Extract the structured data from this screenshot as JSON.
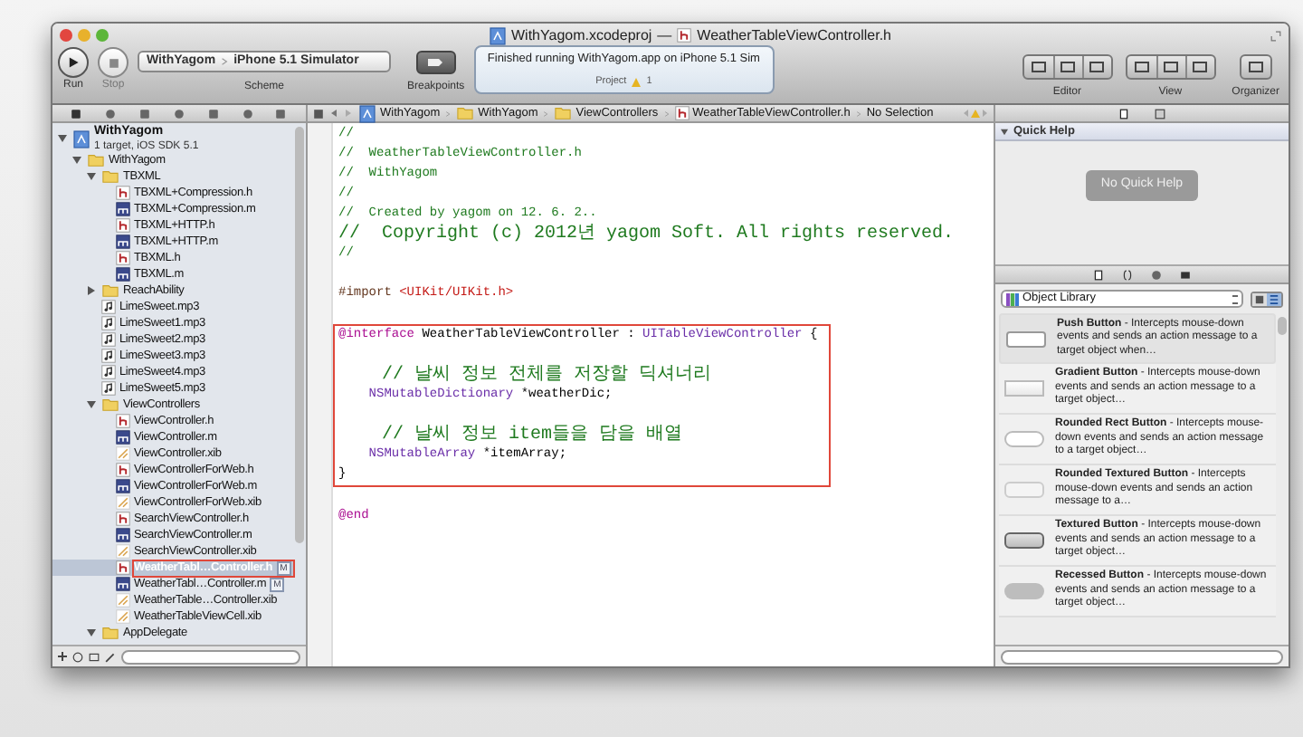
{
  "window": {
    "project": "WithYagom.xcodeproj",
    "separator": "—",
    "file": "WeatherTableViewController.h"
  },
  "toolbar": {
    "run": "Run",
    "stop": "Stop",
    "scheme": "WithYagom",
    "destination": "iPhone 5.1 Simulator",
    "scheme_label": "Scheme",
    "breakpoints": "Breakpoints",
    "editor": "Editor",
    "view": "View",
    "organizer": "Organizer"
  },
  "activity": {
    "status": "Finished running WithYagom.app on iPhone 5.1 Sim",
    "project": "Project",
    "warnings": "1"
  },
  "jump_bar": [
    {
      "kind": "project",
      "label": "WithYagom"
    },
    {
      "kind": "folder",
      "label": "WithYagom"
    },
    {
      "kind": "folder",
      "label": "ViewControllers"
    },
    {
      "kind": "header",
      "label": "WeatherTableViewController.h"
    },
    {
      "kind": "text",
      "label": "No Selection"
    }
  ],
  "navigator": [
    {
      "kind": "project",
      "label": "WithYagom",
      "subtitle": "1 target, iOS SDK 5.1",
      "expanded": true,
      "selected": false,
      "children": [
        {
          "kind": "folder",
          "label": "WithYagom",
          "expanded": true,
          "selected": false,
          "children": [
            {
              "kind": "folder",
              "label": "TBXML",
              "expanded": true,
              "selected": false,
              "children": [
                {
                  "kind": "h",
                  "label": "TBXML+Compression.h",
                  "selected": false
                },
                {
                  "kind": "m",
                  "label": "TBXML+Compression.m",
                  "selected": false
                },
                {
                  "kind": "h",
                  "label": "TBXML+HTTP.h",
                  "selected": false
                },
                {
                  "kind": "m",
                  "label": "TBXML+HTTP.m",
                  "selected": false
                },
                {
                  "kind": "h",
                  "label": "TBXML.h",
                  "selected": false
                },
                {
                  "kind": "m",
                  "label": "TBXML.m",
                  "selected": false
                }
              ]
            },
            {
              "kind": "folder",
              "label": "ReachAbility",
              "expanded": false,
              "selected": false
            },
            {
              "kind": "mp3",
              "label": "LimeSweet.mp3",
              "selected": false
            },
            {
              "kind": "mp3",
              "label": "LimeSweet1.mp3",
              "selected": false
            },
            {
              "kind": "mp3",
              "label": "LimeSweet2.mp3",
              "selected": false
            },
            {
              "kind": "mp3",
              "label": "LimeSweet3.mp3",
              "selected": false
            },
            {
              "kind": "mp3",
              "label": "LimeSweet4.mp3",
              "selected": false
            },
            {
              "kind": "mp3",
              "label": "LimeSweet5.mp3",
              "selected": false
            },
            {
              "kind": "folder",
              "label": "ViewControllers",
              "expanded": true,
              "selected": false,
              "children": [
                {
                  "kind": "h",
                  "label": "ViewController.h",
                  "selected": false
                },
                {
                  "kind": "m",
                  "label": "ViewController.m",
                  "selected": false
                },
                {
                  "kind": "xib",
                  "label": "ViewController.xib",
                  "selected": false
                },
                {
                  "kind": "h",
                  "label": "ViewControllerForWeb.h",
                  "selected": false
                },
                {
                  "kind": "m",
                  "label": "ViewControllerForWeb.m",
                  "selected": false
                },
                {
                  "kind": "xib",
                  "label": "ViewControllerForWeb.xib",
                  "selected": false
                },
                {
                  "kind": "h",
                  "label": "SearchViewController.h",
                  "selected": false
                },
                {
                  "kind": "m",
                  "label": "SearchViewController.m",
                  "selected": false
                },
                {
                  "kind": "xib",
                  "label": "SearchViewController.xib",
                  "selected": false
                },
                {
                  "kind": "h",
                  "label": "WeatherTabl…Controller.h",
                  "selected": true,
                  "boxed": true,
                  "badge": "M"
                },
                {
                  "kind": "m",
                  "label": "WeatherTabl…Controller.m",
                  "selected": false,
                  "badge": "M"
                },
                {
                  "kind": "xib",
                  "label": "WeatherTable…Controller.xib",
                  "selected": false
                },
                {
                  "kind": "xib",
                  "label": "WeatherTableViewCell.xib",
                  "selected": false
                }
              ]
            },
            {
              "kind": "folder",
              "label": "AppDelegate",
              "expanded": true,
              "selected": false
            }
          ]
        }
      ]
    }
  ],
  "code": [
    {
      "boxed": false,
      "lines": [
        {
          "kind": "code",
          "segments": [
            {
              "kind": "comment",
              "text": "//"
            }
          ]
        },
        {
          "kind": "code",
          "segments": [
            {
              "kind": "comment",
              "text": "//  WeatherTableViewController.h"
            }
          ]
        },
        {
          "kind": "code",
          "segments": [
            {
              "kind": "comment",
              "text": "//  WithYagom"
            }
          ]
        },
        {
          "kind": "code",
          "segments": [
            {
              "kind": "comment",
              "text": "//"
            }
          ]
        },
        {
          "kind": "code",
          "segments": [
            {
              "kind": "comment",
              "text": "//  Created by yagom on 12. 6. 2.."
            }
          ]
        },
        {
          "kind": "code",
          "segments": [
            {
              "kind": "comment",
              "text": "//  Copyright (c) 2012년 yagom Soft. All rights reserved."
            }
          ]
        },
        {
          "kind": "code",
          "segments": [
            {
              "kind": "comment",
              "text": "//"
            }
          ]
        },
        {
          "kind": "blank"
        },
        {
          "kind": "code",
          "segments": [
            {
              "kind": "directive",
              "text": "#import "
            },
            {
              "kind": "string",
              "text": "<UIKit/UIKit.h>"
            }
          ]
        },
        {
          "kind": "blank"
        }
      ]
    },
    {
      "boxed": true,
      "lines": [
        {
          "kind": "code",
          "segments": [
            {
              "kind": "keyword",
              "text": "@interface"
            },
            {
              "kind": "plain",
              "text": " WeatherTableViewController : "
            },
            {
              "kind": "type",
              "text": "UITableViewController"
            },
            {
              "kind": "plain",
              "text": " {"
            }
          ]
        },
        {
          "kind": "blank"
        },
        {
          "kind": "code",
          "segments": [
            {
              "kind": "comment",
              "text": "    // 날씨 정보 전체를 저장할 딕셔너리"
            }
          ]
        },
        {
          "kind": "code",
          "segments": [
            {
              "kind": "type",
              "text": "    NSMutableDictionary"
            },
            {
              "kind": "plain",
              "text": " *weatherDic;"
            }
          ]
        },
        {
          "kind": "blank"
        },
        {
          "kind": "code",
          "segments": [
            {
              "kind": "comment",
              "text": "    // 날씨 정보 item들을 담을 배열"
            }
          ]
        },
        {
          "kind": "code",
          "segments": [
            {
              "kind": "type",
              "text": "    NSMutableArray"
            },
            {
              "kind": "plain",
              "text": " *itemArray;"
            }
          ]
        },
        {
          "kind": "code",
          "segments": [
            {
              "kind": "plain",
              "text": "}"
            }
          ]
        }
      ]
    },
    {
      "boxed": false,
      "lines": [
        {
          "kind": "blank"
        },
        {
          "kind": "code",
          "segments": [
            {
              "kind": "keyword",
              "text": "@end"
            }
          ]
        }
      ]
    }
  ],
  "quick_help": {
    "title": "Quick Help",
    "message": "No Quick Help"
  },
  "library": {
    "selector": "Object Library",
    "items": [
      {
        "kind": "push",
        "name": "Push Button",
        "description": "- Intercepts mouse-down events and sends an action message to a target object when…",
        "selected": true
      },
      {
        "kind": "gradient",
        "name": "Gradient Button",
        "description": "- Intercepts mouse-down events and sends an action message to a target object…",
        "selected": false
      },
      {
        "kind": "rounded_rect",
        "name": "Rounded Rect Button",
        "description": "- Intercepts mouse-down events and sends an action message to a target object…",
        "selected": false
      },
      {
        "kind": "rounded_textured",
        "name": "Rounded Textured Button",
        "description": "- Intercepts mouse-down events and sends an action message to a…",
        "selected": false
      },
      {
        "kind": "textured",
        "name": "Textured Button",
        "description": "- Intercepts mouse-down events and sends an action message to a target object…",
        "selected": false
      },
      {
        "kind": "recessed",
        "name": "Recessed Button",
        "description": "- Intercepts mouse-down events and sends an action message to a target object…",
        "selected": false
      }
    ]
  }
}
